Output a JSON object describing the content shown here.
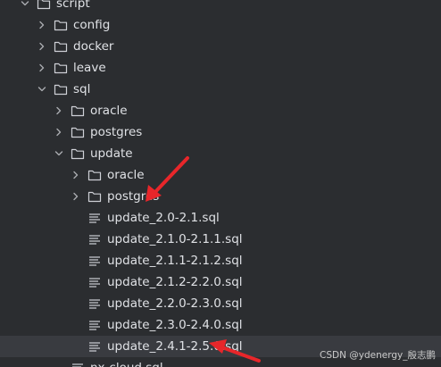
{
  "tree": {
    "items": [
      {
        "label": "script",
        "type": "folder",
        "expanded": true,
        "depth": 0,
        "icon": "folder-icon"
      },
      {
        "label": "config",
        "type": "folder",
        "expanded": false,
        "depth": 1,
        "icon": "folder-icon"
      },
      {
        "label": "docker",
        "type": "folder",
        "expanded": false,
        "depth": 1,
        "icon": "folder-icon"
      },
      {
        "label": "leave",
        "type": "folder",
        "expanded": false,
        "depth": 1,
        "icon": "folder-icon"
      },
      {
        "label": "sql",
        "type": "folder",
        "expanded": true,
        "depth": 1,
        "icon": "folder-icon"
      },
      {
        "label": "oracle",
        "type": "folder",
        "expanded": false,
        "depth": 2,
        "icon": "folder-icon"
      },
      {
        "label": "postgres",
        "type": "folder",
        "expanded": false,
        "depth": 2,
        "icon": "folder-icon"
      },
      {
        "label": "update",
        "type": "folder",
        "expanded": true,
        "depth": 2,
        "icon": "folder-icon"
      },
      {
        "label": "oracle",
        "type": "folder",
        "expanded": false,
        "depth": 3,
        "icon": "folder-icon"
      },
      {
        "label": "postgres",
        "type": "folder",
        "expanded": false,
        "depth": 3,
        "icon": "folder-icon"
      },
      {
        "label": "update_2.0-2.1.sql",
        "type": "file",
        "depth": 3,
        "icon": "sql-file-icon"
      },
      {
        "label": "update_2.1.0-2.1.1.sql",
        "type": "file",
        "depth": 3,
        "icon": "sql-file-icon"
      },
      {
        "label": "update_2.1.1-2.1.2.sql",
        "type": "file",
        "depth": 3,
        "icon": "sql-file-icon"
      },
      {
        "label": "update_2.1.2-2.2.0.sql",
        "type": "file",
        "depth": 3,
        "icon": "sql-file-icon"
      },
      {
        "label": "update_2.2.0-2.3.0.sql",
        "type": "file",
        "depth": 3,
        "icon": "sql-file-icon"
      },
      {
        "label": "update_2.3.0-2.4.0.sql",
        "type": "file",
        "depth": 3,
        "icon": "sql-file-icon"
      },
      {
        "label": "update_2.4.1-2.5.0.sql",
        "type": "file",
        "depth": 3,
        "icon": "sql-file-icon",
        "selected": true
      },
      {
        "label": "nx-cloud.sql",
        "type": "file",
        "depth": 2,
        "icon": "sql-file-icon"
      }
    ]
  },
  "watermark": "CSDN @ydenergy_殷志鹏",
  "colors": {
    "background": "#2b2d30",
    "selected_row": "#393b40",
    "text": "#dfe1e5",
    "icon": "#ced0d6",
    "annotation_arrow": "#e8262a"
  }
}
